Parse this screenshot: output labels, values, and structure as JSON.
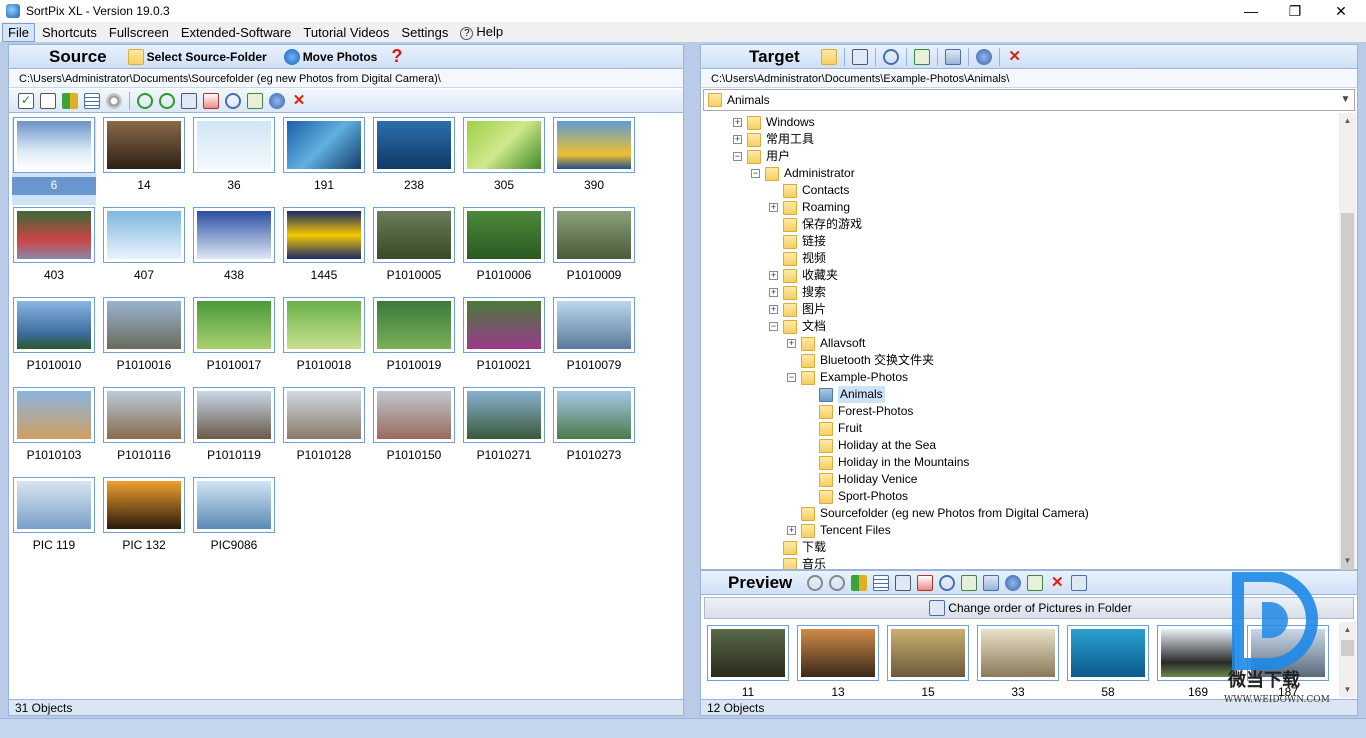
{
  "window": {
    "title": "SortPix XL - Version 19.0.3",
    "controls": {
      "minimize": "—",
      "maximize": "❐",
      "close": "✕"
    }
  },
  "menu": {
    "items": [
      "File",
      "Shortcuts",
      "Fullscreen",
      "Extended-Software",
      "Tutorial Videos",
      "Settings",
      "Help"
    ],
    "active": "File"
  },
  "source": {
    "title": "Source",
    "select_folder_label": "Select Source-Folder",
    "move_photos_label": "Move Photos",
    "help_glyph": "?",
    "path": "C:\\Users\\Administrator\\Documents\\Sourcefolder (eg new Photos from Digital Camera)\\",
    "photos": [
      "6",
      "14",
      "36",
      "191",
      "238",
      "305",
      "390",
      "403",
      "407",
      "438",
      "1445",
      "P1010005",
      "P1010006",
      "P1010009",
      "P1010010",
      "P1010016",
      "P1010017",
      "P1010018",
      "P1010019",
      "P1010021",
      "P1010079",
      "P1010103",
      "P1010116",
      "P1010119",
      "P1010128",
      "P1010150",
      "P1010271",
      "P1010273",
      "PIC 119",
      "PIC 132",
      "PIC9086"
    ],
    "selected": "6",
    "status": "31 Objects"
  },
  "target": {
    "title": "Target",
    "path": "C:\\Users\\Administrator\\Documents\\Example-Photos\\Animals\\",
    "combo_value": "Animals",
    "tree": [
      {
        "label": "Windows",
        "expander": "+"
      },
      {
        "label": "常用工具",
        "expander": "+"
      },
      {
        "label": "用户",
        "expander": "−"
      },
      {
        "label": "Administrator",
        "expander": "−"
      },
      {
        "label": "Contacts",
        "expander": ""
      },
      {
        "label": "Roaming",
        "expander": "+"
      },
      {
        "label": "保存的游戏",
        "expander": ""
      },
      {
        "label": "链接",
        "expander": ""
      },
      {
        "label": "视频",
        "expander": ""
      },
      {
        "label": "收藏夹",
        "expander": "+"
      },
      {
        "label": "搜索",
        "expander": "+"
      },
      {
        "label": "图片",
        "expander": "+"
      },
      {
        "label": "文档",
        "expander": "−"
      },
      {
        "label": "Allavsoft",
        "expander": "+"
      },
      {
        "label": "Bluetooth 交换文件夹",
        "expander": ""
      },
      {
        "label": "Example-Photos",
        "expander": "−"
      },
      {
        "label": "Animals",
        "expander": ""
      },
      {
        "label": "Forest-Photos",
        "expander": ""
      },
      {
        "label": "Fruit",
        "expander": ""
      },
      {
        "label": "Holiday at the Sea",
        "expander": ""
      },
      {
        "label": "Holiday in the Mountains",
        "expander": ""
      },
      {
        "label": "Holiday Venice",
        "expander": ""
      },
      {
        "label": "Sport-Photos",
        "expander": ""
      },
      {
        "label": "Sourcefolder (eg new Photos from Digital Camera)",
        "expander": ""
      },
      {
        "label": "Tencent Files",
        "expander": "+"
      },
      {
        "label": "下载",
        "expander": ""
      },
      {
        "label": "音乐",
        "expander": ""
      }
    ],
    "selected_node": "Animals"
  },
  "preview": {
    "title": "Preview",
    "change_order_label": "Change order of Pictures in Folder",
    "photos": [
      "11",
      "13",
      "15",
      "33",
      "58",
      "169",
      "187"
    ],
    "status": "12 Objects"
  },
  "watermark": {
    "text": "微当下载",
    "url": "WWW.WEIDOWN.COM"
  },
  "colors": {
    "accent": "#6f9fd3",
    "panel_border": "#9ab4d9",
    "background": "#b9cbe6"
  }
}
